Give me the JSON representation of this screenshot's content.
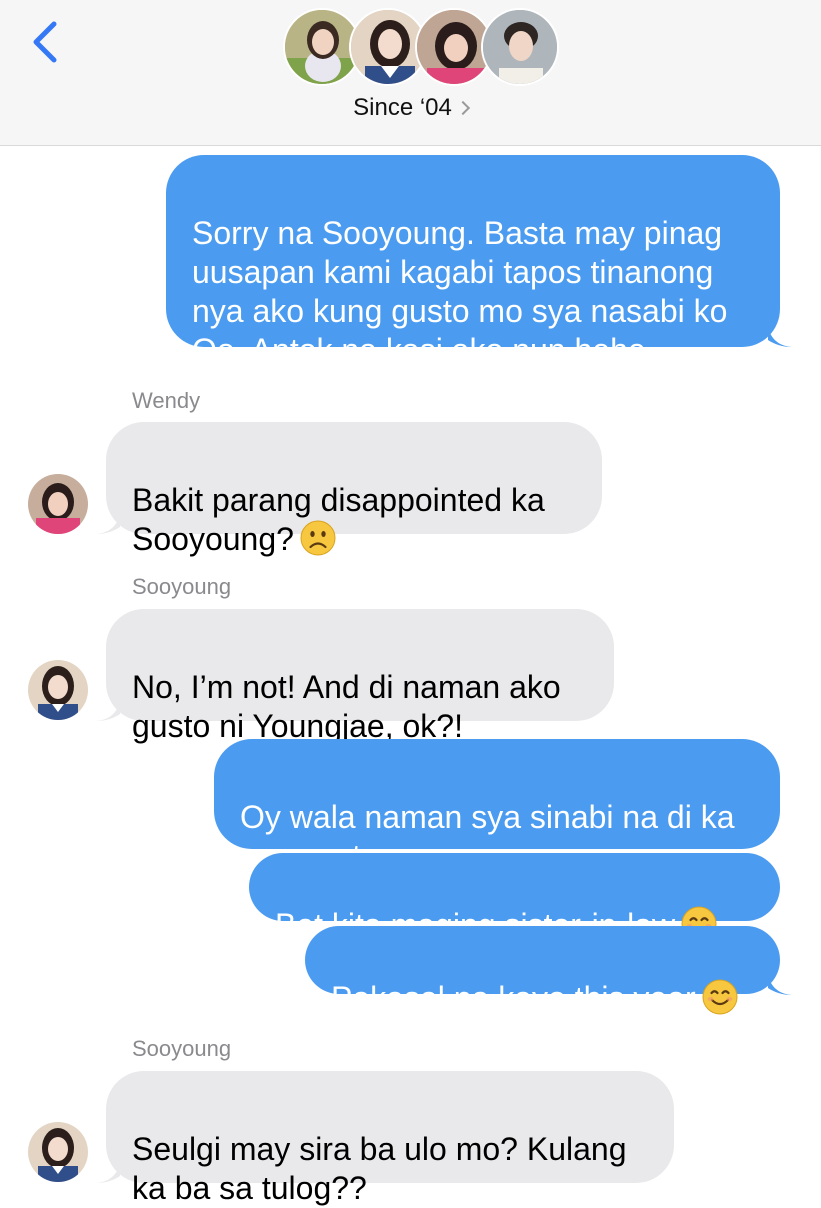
{
  "header": {
    "group_name": "Since ‘04",
    "back_icon": "chevron-left-icon",
    "colors": {
      "accent": "#3478f6",
      "header_bg": "#f6f6f6"
    }
  },
  "colors": {
    "outgoing_bubble": "#4b9cf0",
    "incoming_bubble": "#e9e9eb",
    "sender_label": "#8a8a8e"
  },
  "messages": [
    {
      "direction": "outgoing",
      "text": "Sorry na Sooyoung. Basta may pinag\nuusapan kami kagabi tapos tinanong\nnya ako kung gusto mo sya nasabi ko\nOo. Antok na kasi ako nun hehe"
    },
    {
      "direction": "incoming",
      "sender": "Wendy",
      "text": "Bakit parang disappointed ka\nSooyoung?",
      "emoji": "frowning-face"
    },
    {
      "direction": "incoming",
      "sender": "Sooyoung",
      "text": "No, I’m not! And di naman ako\ngusto ni Youngjae, ok?!"
    },
    {
      "direction": "outgoing",
      "text": "Oy wala naman sya sinabi na di ka\nnya gusto"
    },
    {
      "direction": "outgoing",
      "text": "Bet kita maging sister-in-law",
      "emoji": "smiling-face"
    },
    {
      "direction": "outgoing",
      "text": "Pakasal na kayo this year",
      "emoji": "smiling-face"
    },
    {
      "direction": "incoming",
      "sender": "Sooyoung",
      "text": "Seulgi may sira ba ulo mo? Kulang\nka ba sa tulog??"
    }
  ]
}
